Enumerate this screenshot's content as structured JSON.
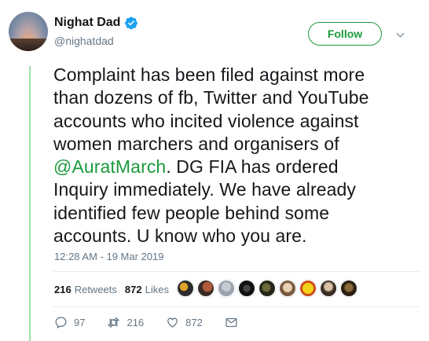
{
  "author": {
    "display_name": "Nighat Dad",
    "handle": "@nighatdad"
  },
  "follow_label": "Follow",
  "tweet": {
    "line1": "Complaint has been filed against more",
    "line2": "than dozens of fb, Twitter and YouTube",
    "line3": "accounts who incited violence against",
    "line4": "women marchers and organisers of",
    "mention": "@AuratMarch",
    "line5_rest": ". DG FIA has ordered",
    "line6": "Inquiry immediately. We have already",
    "line7": "identified few people behind some",
    "line8": "accounts. U know who you are."
  },
  "timestamp": "12:28 AM - 19 Mar 2019",
  "stats": {
    "retweets_count": "216",
    "retweets_label": "Retweets",
    "likes_count": "872",
    "likes_label": "Likes"
  },
  "actions": {
    "replies": "97",
    "retweets": "216",
    "likes": "872"
  },
  "colors": {
    "accent": "#1b9a3c",
    "thread_line": "#9ee2a8",
    "verified": "#1da1f2",
    "muted": "#657786"
  },
  "icons": [
    "verified-badge-icon",
    "chevron-down-icon",
    "reply-icon",
    "retweet-icon",
    "like-icon",
    "direct-message-icon"
  ]
}
